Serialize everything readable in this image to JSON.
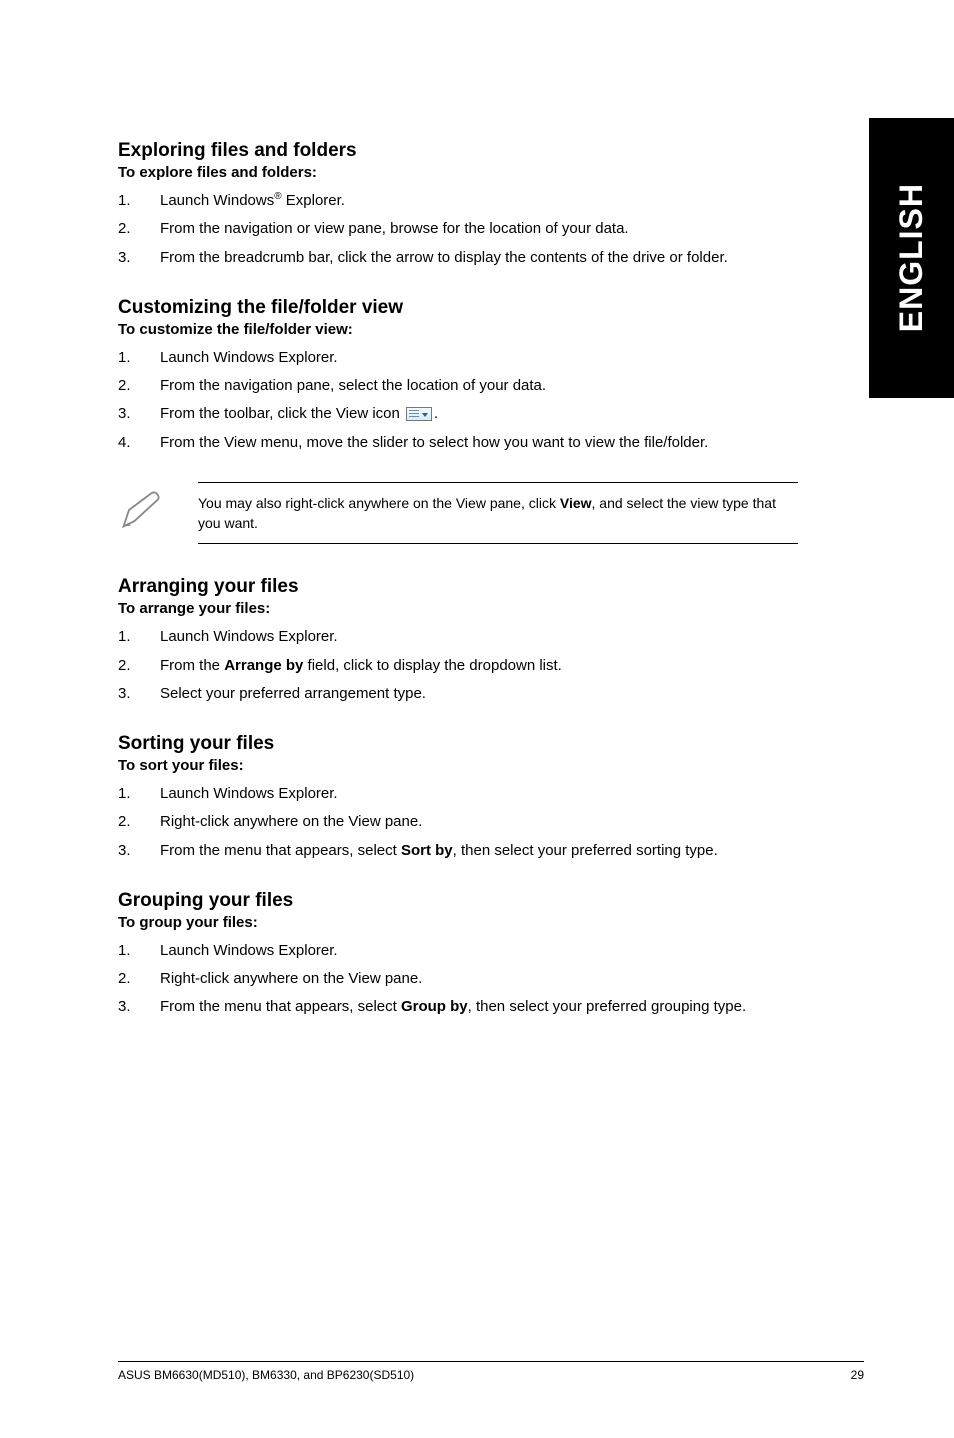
{
  "sideTab": "ENGLISH",
  "sections": {
    "exploring": {
      "title": "Exploring files and folders",
      "sub": "To explore files and folders:",
      "item1_pre": "Launch Windows",
      "item1_sup": "®",
      "item1_post": " Explorer.",
      "item2": "From the navigation or view pane, browse for the location of your data.",
      "item3": "From the breadcrumb bar, click the arrow to display the contents of the drive or folder."
    },
    "customizing": {
      "title": "Customizing the file/folder view",
      "sub": "To customize the file/folder view:",
      "item1": "Launch Windows Explorer.",
      "item2": "From the navigation pane, select the location of your data.",
      "item3_pre": "From the toolbar, click the View icon ",
      "item3_post": ".",
      "item4": "From the View menu, move the slider to select how you want to view the file/folder."
    },
    "note": {
      "pre": "You may also right-click anywhere on the View pane, click ",
      "bold": "View",
      "post": ", and select the view type that you want."
    },
    "arranging": {
      "title": "Arranging your files",
      "sub": "To arrange your files:",
      "item1": "Launch Windows Explorer.",
      "item2_pre": "From the ",
      "item2_bold": "Arrange by",
      "item2_post": " field, click to display the dropdown list.",
      "item3": "Select your preferred arrangement type."
    },
    "sorting": {
      "title": "Sorting your files",
      "sub": "To sort your files:",
      "item1": "Launch Windows Explorer.",
      "item2": "Right-click anywhere on the View pane.",
      "item3_pre": "From the menu that appears, select ",
      "item3_bold": "Sort by",
      "item3_post": ", then select your preferred sorting type."
    },
    "grouping": {
      "title": "Grouping your files",
      "sub": "To group your files:",
      "item1": "Launch Windows Explorer.",
      "item2": "Right-click anywhere on the View pane.",
      "item3_pre": "From the menu that appears, select ",
      "item3_bold": "Group by",
      "item3_post": ", then select your preferred grouping type."
    }
  },
  "nums": {
    "n1": "1.",
    "n2": "2.",
    "n3": "3.",
    "n4": "4."
  },
  "footer": {
    "left": "ASUS BM6630(MD510), BM6330, and BP6230(SD510)",
    "right": "29"
  }
}
